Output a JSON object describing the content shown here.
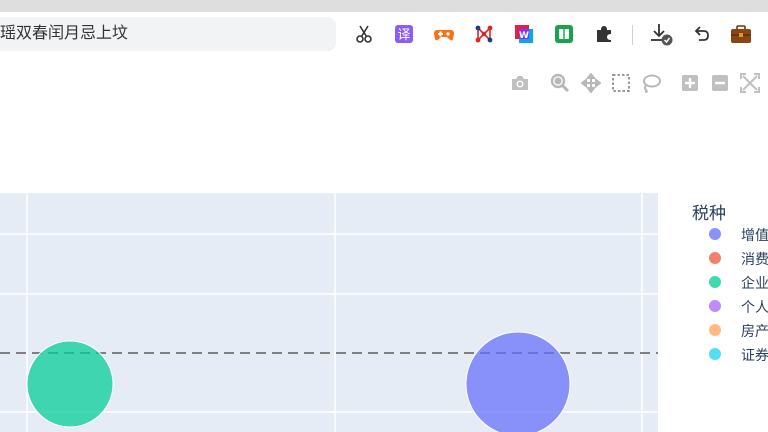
{
  "browser": {
    "address_text": "瑶双春闰月忌上坟",
    "extensions": [
      {
        "name": "scissors-icon",
        "color": "#333333"
      },
      {
        "name": "translate-icon",
        "color": "#8b5cf6",
        "label": "译"
      },
      {
        "name": "gamepad-icon",
        "color": "#f97316"
      },
      {
        "name": "network-icon",
        "color": "#dc2626"
      },
      {
        "name": "office-icon",
        "color": "#e11d48"
      },
      {
        "name": "book-icon",
        "color": "#16a34a"
      },
      {
        "name": "puzzle-icon",
        "color": "#333333"
      },
      {
        "name": "download-icon",
        "color": "#333333"
      },
      {
        "name": "undo-icon",
        "color": "#333333"
      },
      {
        "name": "briefcase-icon",
        "color": "#8b4513"
      }
    ]
  },
  "modebar": {
    "buttons": [
      "camera-icon",
      "zoom-icon",
      "pan-icon",
      "box-select-icon",
      "lasso-icon",
      "zoom-in-icon",
      "zoom-out-icon",
      "autoscale-icon"
    ]
  },
  "legend": {
    "title": "税种",
    "items": [
      {
        "label": "增值",
        "color": "#636efa"
      },
      {
        "label": "消费",
        "color": "#ef553b"
      },
      {
        "label": "企业",
        "color": "#00cc96"
      },
      {
        "label": "个人",
        "color": "#ab63fa"
      },
      {
        "label": "房产",
        "color": "#ffa15a"
      },
      {
        "label": "证券",
        "color": "#19d3f3"
      }
    ]
  },
  "chart_data": {
    "type": "scatter",
    "title": "",
    "xlabel": "",
    "ylabel": "",
    "grid": true,
    "legend_position": "right",
    "reference_line": {
      "style": "dashed",
      "color": "#808080"
    },
    "series": [
      {
        "name": "企业",
        "color": "#00cc96",
        "size": 86
      },
      {
        "name": "增值",
        "color": "#636efa",
        "size": 104
      }
    ]
  }
}
